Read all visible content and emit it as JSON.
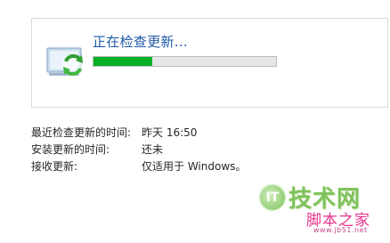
{
  "update_status": {
    "title": "正在检查更新...",
    "progress_fraction": 0.32,
    "icon": "windows-update-icon"
  },
  "info_rows": [
    {
      "label": "最近检查更新的时间:",
      "value": "昨天 16:50"
    },
    {
      "label": "安装更新的时间:",
      "value": "还未"
    },
    {
      "label": "接收更新:",
      "value": "仅适用于 Windows。"
    }
  ],
  "watermark": {
    "badge": "IT",
    "main_text": "技术网",
    "sub_text": "脚本之家",
    "url_text": "www.jb51.net"
  },
  "colors": {
    "title_blue": "#1e5aa6",
    "progress_green": "#06b025",
    "watermark_green": "#7fc25a",
    "watermark_pink": "#e6318a"
  }
}
